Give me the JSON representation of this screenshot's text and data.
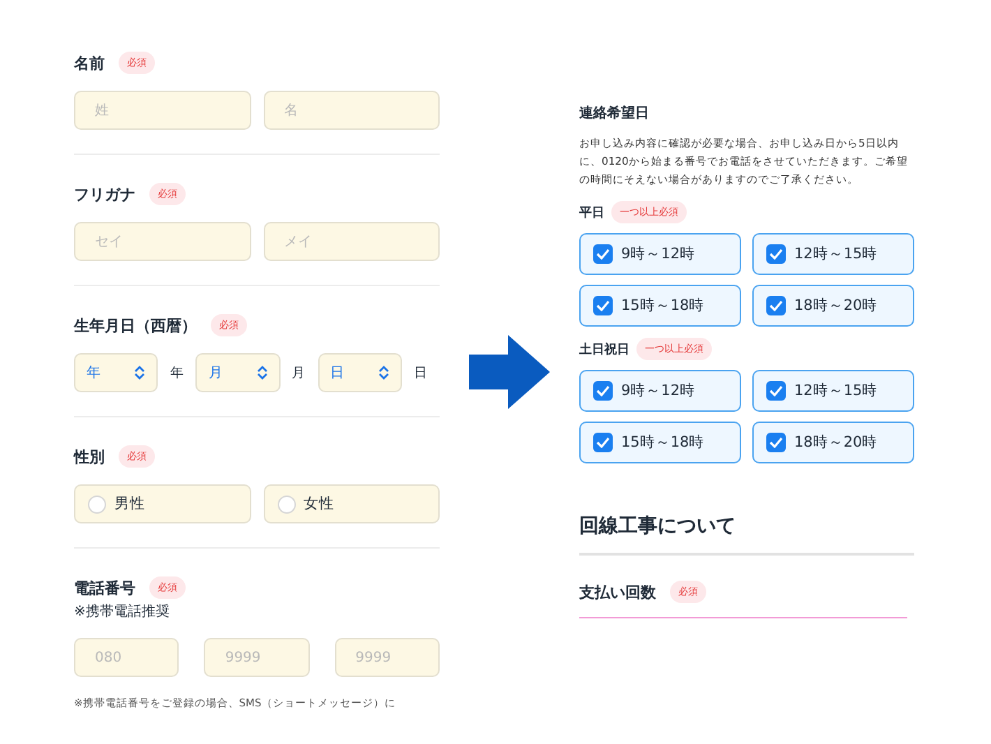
{
  "left_sections": [
    {
      "kind": "pair",
      "label": "名前",
      "badge": "必須",
      "fields": [
        {
          "placeholder": "姓"
        },
        {
          "placeholder": "名"
        }
      ]
    },
    {
      "kind": "pair",
      "label": "フリガナ",
      "badge": "必須",
      "fields": [
        {
          "placeholder": "セイ"
        },
        {
          "placeholder": "メイ"
        }
      ]
    },
    {
      "kind": "date",
      "label": "生年月日（西暦）",
      "badge": "必須",
      "selects": [
        {
          "value": "年",
          "unit": "年"
        },
        {
          "value": "月",
          "unit": "月"
        },
        {
          "value": "日",
          "unit": "日"
        }
      ]
    },
    {
      "kind": "radio",
      "label": "性別",
      "badge": "必須",
      "options": [
        {
          "label": "男性",
          "selected": false
        },
        {
          "label": "女性",
          "selected": false
        }
      ]
    },
    {
      "kind": "phone",
      "label": "電話番号",
      "badge": "必須",
      "note": "※携帯電話推奨",
      "fields": [
        {
          "placeholder": "080"
        },
        {
          "placeholder": "9999"
        },
        {
          "placeholder": "9999"
        }
      ],
      "footnote": "※携帯電話番号をご登録の場合、SMS（ショートメッセージ）に"
    }
  ],
  "contact": {
    "title": "連絡希望日",
    "description": "お申し込み内容に確認が必要な場合、お申し込み日から5日以内に、0120から始まる番号でお電話をさせていただきます。ご希望の時間にそえない場合がありますのでご了承ください。",
    "groups": [
      {
        "label": "平日",
        "badge": "一つ以上必須",
        "slots": [
          {
            "label": "9時～12時",
            "checked": true
          },
          {
            "label": "12時～15時",
            "checked": true
          },
          {
            "label": "15時～18時",
            "checked": true
          },
          {
            "label": "18時～20時",
            "checked": true
          }
        ]
      },
      {
        "label": "土日祝日",
        "badge": "一つ以上必須",
        "slots": [
          {
            "label": "9時～12時",
            "checked": true
          },
          {
            "label": "12時～15時",
            "checked": true
          },
          {
            "label": "15時～18時",
            "checked": true
          },
          {
            "label": "18時～20時",
            "checked": true
          }
        ]
      }
    ]
  },
  "construction": {
    "title": "回線工事について",
    "fields": [
      {
        "label": "支払い回数",
        "badge": "必須"
      }
    ]
  }
}
